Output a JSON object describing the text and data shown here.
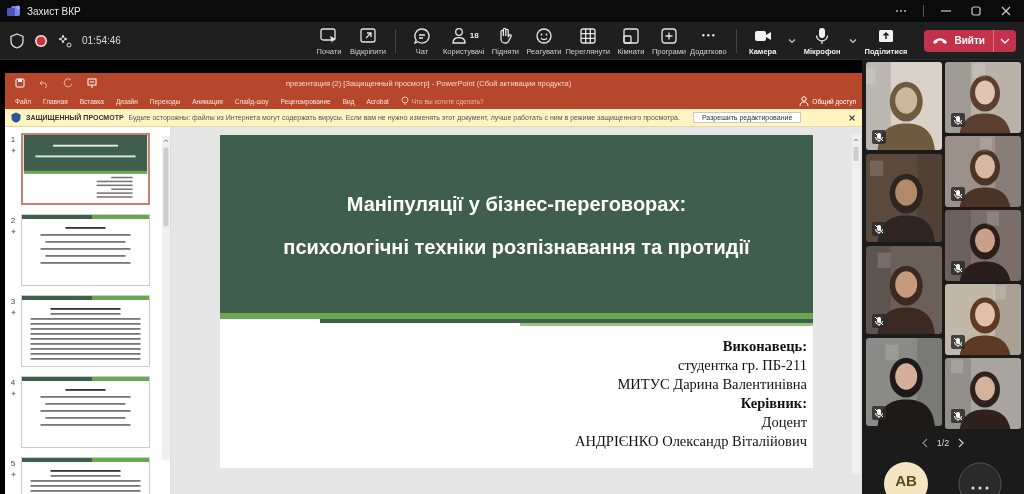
{
  "window": {
    "title": "Захист ВКР"
  },
  "meeting": {
    "elapsed": "01:54:46",
    "recording": true
  },
  "toolbar": [
    {
      "kind": "start",
      "label": "Почати"
    },
    {
      "kind": "unpin",
      "label": "Відкріпити"
    },
    {
      "kind": "sep"
    },
    {
      "kind": "chat",
      "label": "Чат"
    },
    {
      "kind": "people",
      "label": "Користувачі",
      "count": "18"
    },
    {
      "kind": "hand",
      "label": "Підняти"
    },
    {
      "kind": "react",
      "label": "Реагувати"
    },
    {
      "kind": "grid",
      "label": "Переглянути"
    },
    {
      "kind": "rooms",
      "label": "Кімнати"
    },
    {
      "kind": "apps",
      "label": "Програми"
    },
    {
      "kind": "more",
      "label": "Додатково"
    },
    {
      "kind": "sep"
    },
    {
      "kind": "camera",
      "label": "Камера",
      "menu": true
    },
    {
      "kind": "mic",
      "label": "Мікрофон",
      "menu": true
    },
    {
      "kind": "share",
      "label": "Поділитися"
    }
  ],
  "leave_button": {
    "label": "Вийти"
  },
  "powerpoint": {
    "title": "презентация (2) [Защищенный просмотр] - PowerPoint (Сбой активации продукта)",
    "ribbon_tabs": [
      "Файл",
      "Главная",
      "Вставка",
      "Дизайн",
      "Переходы",
      "Анимация",
      "Слайд-шоу",
      "Рецензирование",
      "Вид",
      "Acrobat"
    ],
    "search_hint": "Что вы хотите сделать?",
    "share_label": "Общий доступ",
    "protected_view": {
      "label": "ЗАЩИЩЕННЫЙ ПРОСМОТР",
      "message": "Будьте осторожны: файлы из Интернета могут содержать вирусы. Если вам не нужно изменять этот документ, лучше работать с ним в режиме защищенного просмотра.",
      "button": "Разрешить редактирование"
    },
    "thumbnails": [
      {
        "number": "1",
        "kind": "title",
        "selected": true
      },
      {
        "number": "2",
        "kind": "text",
        "selected": false
      },
      {
        "number": "3",
        "kind": "list",
        "selected": false
      },
      {
        "number": "4",
        "kind": "text",
        "selected": false
      },
      {
        "number": "5",
        "kind": "list",
        "selected": false
      }
    ],
    "slide": {
      "title_lines": [
        "Маніпуляції у бізнес-переговорах:",
        "психологічні техніки розпізнавання та протидії"
      ],
      "credits": [
        {
          "text": "Виконавець:",
          "bold": true
        },
        {
          "text": "студентка гр. ПБ-211",
          "bold": false
        },
        {
          "text": "МИТУС Дарина Валентинівна",
          "bold": false
        },
        {
          "text": "Керівник:",
          "bold": true
        },
        {
          "text": "Доцент",
          "bold": false
        },
        {
          "text": "АНДРІЄНКО Олександр Віталійович",
          "bold": false
        }
      ]
    }
  },
  "video_columns": [
    {
      "tiles": [
        {
          "kind": "picture",
          "muted": true
        },
        {
          "kind": "picture",
          "muted": true
        },
        {
          "kind": "picture",
          "muted": true
        },
        {
          "kind": "picture",
          "muted": true
        }
      ]
    },
    {
      "tiles": [
        {
          "kind": "picture",
          "muted": true
        },
        {
          "kind": "picture",
          "muted": true
        },
        {
          "kind": "picture",
          "muted": true
        },
        {
          "kind": "picture",
          "muted": true
        },
        {
          "kind": "picture",
          "muted": true
        }
      ]
    }
  ],
  "pager": "1/2",
  "avatar": {
    "initials": "AB"
  }
}
